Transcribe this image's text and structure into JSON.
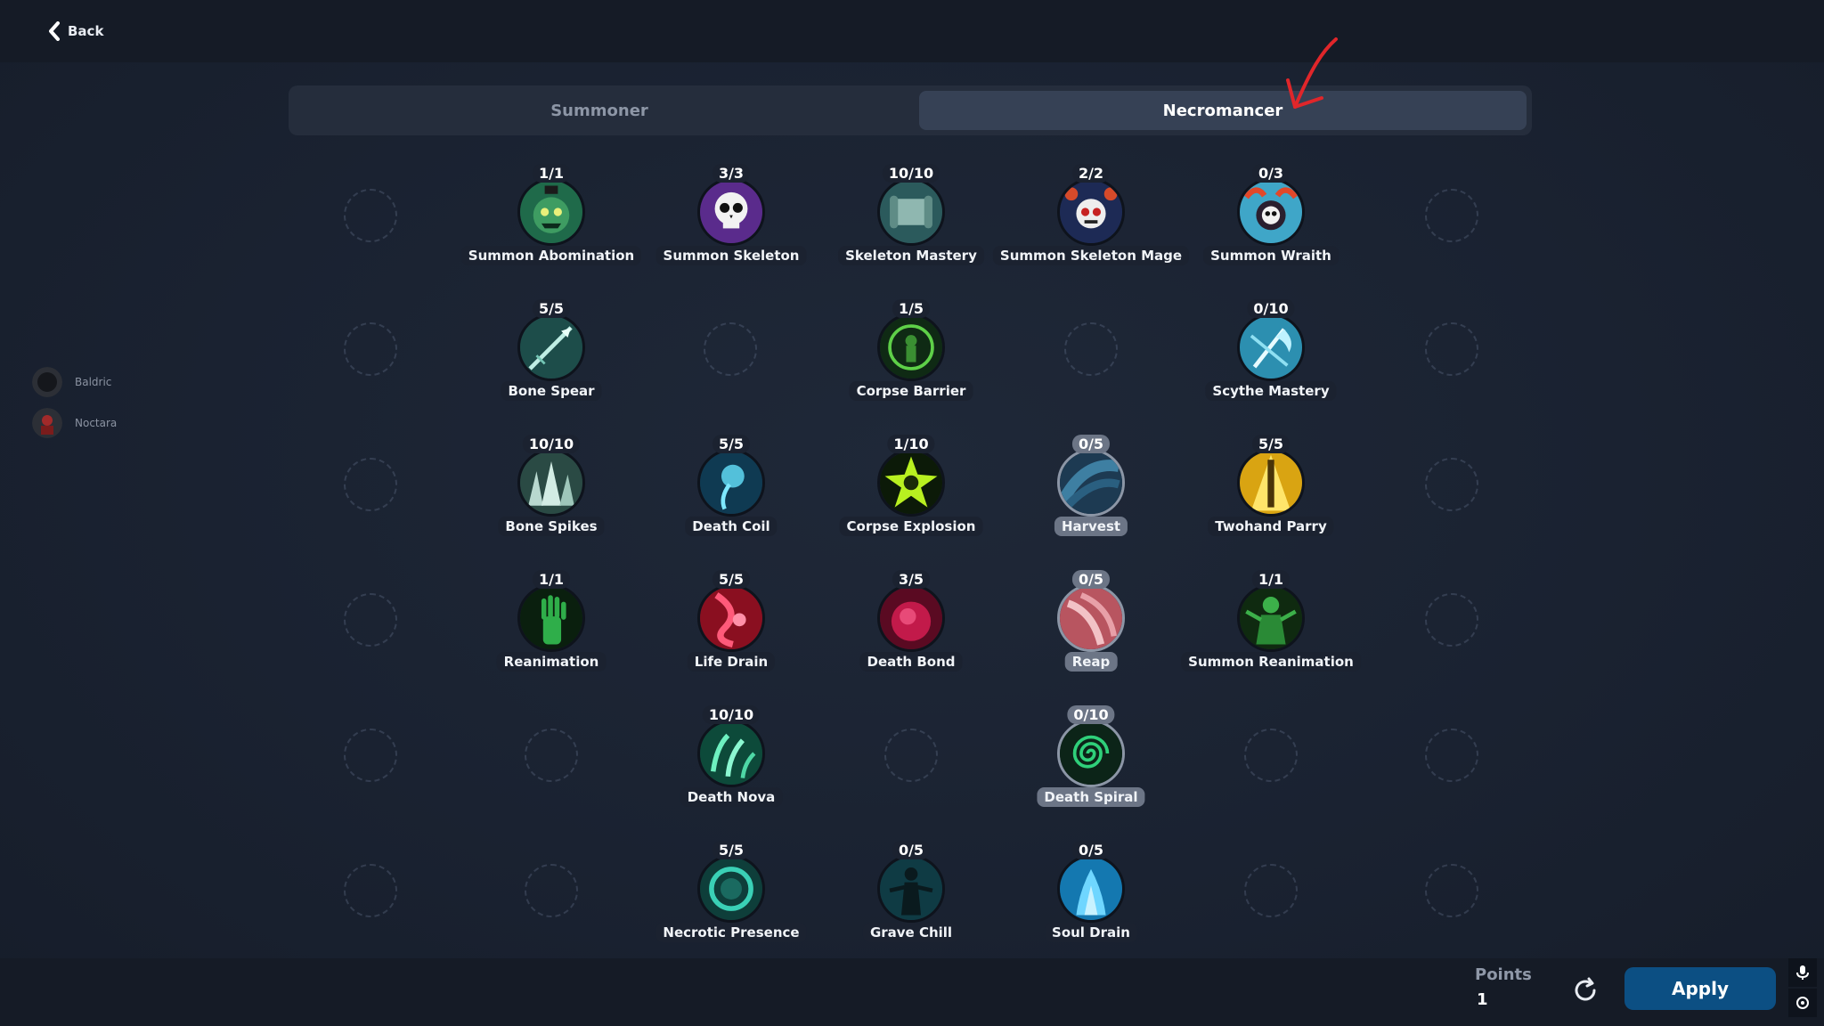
{
  "nav": {
    "back_label": "Back"
  },
  "tabs": [
    {
      "label": "Summoner",
      "active": false
    },
    {
      "label": "Necromancer",
      "active": true
    }
  ],
  "party": [
    {
      "name": "Baldric"
    },
    {
      "name": "Noctara"
    }
  ],
  "skills": [
    {
      "name": "Summon Abomination",
      "rank": "1/1",
      "icon": "abomination-icon"
    },
    {
      "name": "Summon Skeleton",
      "rank": "3/3",
      "icon": "skull-icon"
    },
    {
      "name": "Skeleton Mastery",
      "rank": "10/10",
      "icon": "scroll-icon"
    },
    {
      "name": "Summon Skeleton Mage",
      "rank": "2/2",
      "icon": "skeleton-mage-icon"
    },
    {
      "name": "Summon Wraith",
      "rank": "0/3",
      "icon": "wraith-icon"
    },
    {
      "name": "Bone Spear",
      "rank": "5/5",
      "icon": "spear-icon"
    },
    {
      "name": "Corpse Barrier",
      "rank": "1/5",
      "icon": "barrier-icon"
    },
    {
      "name": "Scythe Mastery",
      "rank": "0/10",
      "icon": "scythe-icon"
    },
    {
      "name": "Bone Spikes",
      "rank": "10/10",
      "icon": "spikes-icon"
    },
    {
      "name": "Death Coil",
      "rank": "5/5",
      "icon": "coil-icon"
    },
    {
      "name": "Corpse Explosion",
      "rank": "1/10",
      "icon": "explosion-icon"
    },
    {
      "name": "Harvest",
      "rank": "0/5",
      "icon": "harvest-icon",
      "locked": true
    },
    {
      "name": "Twohand Parry",
      "rank": "5/5",
      "icon": "parry-icon"
    },
    {
      "name": "Reanimation",
      "rank": "1/1",
      "icon": "hand-icon"
    },
    {
      "name": "Life Drain",
      "rank": "5/5",
      "icon": "life-drain-icon"
    },
    {
      "name": "Death Bond",
      "rank": "3/5",
      "icon": "death-bond-icon"
    },
    {
      "name": "Reap",
      "rank": "0/5",
      "icon": "reap-icon",
      "locked": true
    },
    {
      "name": "Summon Reanimation",
      "rank": "1/1",
      "icon": "reanimation-icon"
    },
    {
      "name": "Death Nova",
      "rank": "10/10",
      "icon": "nova-icon"
    },
    {
      "name": "Death Spiral",
      "rank": "0/10",
      "icon": "spiral-icon",
      "locked": true
    },
    {
      "name": "Necrotic Presence",
      "rank": "5/5",
      "icon": "presence-icon"
    },
    {
      "name": "Grave Chill",
      "rank": "0/5",
      "icon": "grave-chill-icon"
    },
    {
      "name": "Soul Drain",
      "rank": "0/5",
      "icon": "soul-drain-icon"
    }
  ],
  "footer": {
    "points_label": "Points",
    "points_value": "1",
    "apply_label": "Apply"
  },
  "colors": {
    "accent": "#0c4f83",
    "annotation_arrow": "#e0262a"
  }
}
